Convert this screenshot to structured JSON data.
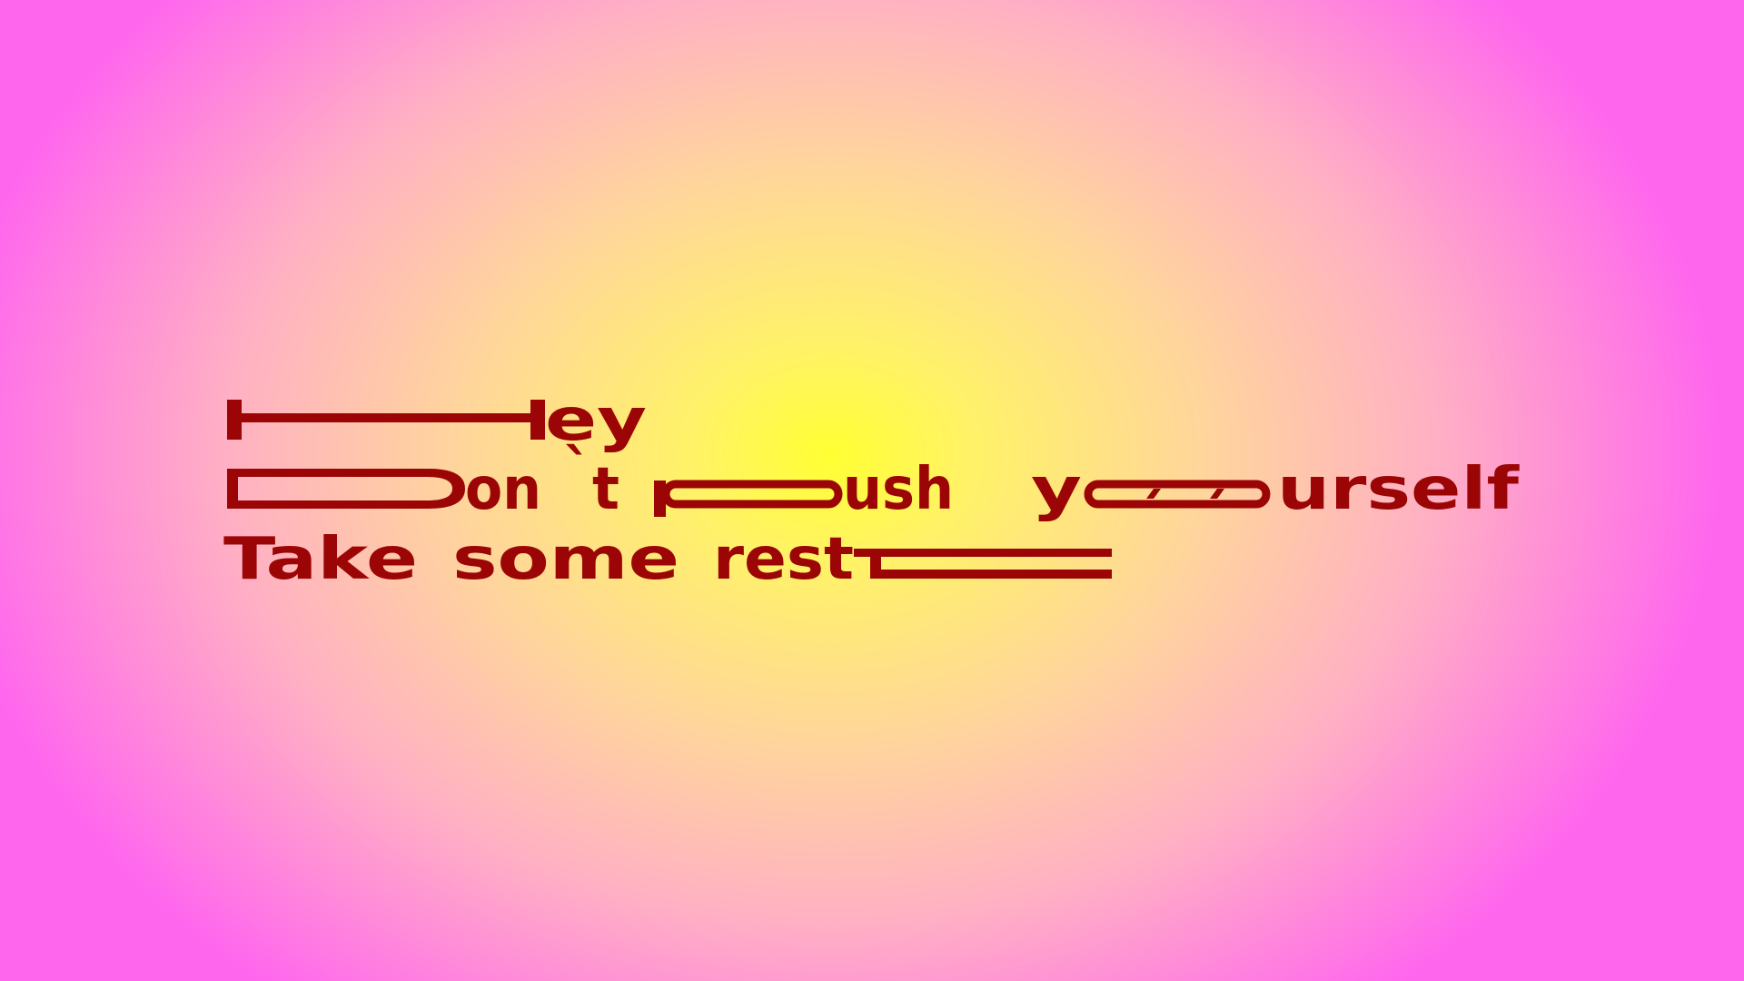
{
  "poster": {
    "lines": [
      {
        "segments": [
          "ey"
        ]
      },
      {
        "segments": [
          "on",
          "`",
          "t",
          "p",
          "ush",
          "y",
          "urself"
        ]
      },
      {
        "segments": [
          "Take",
          "some",
          "rest"
        ]
      }
    ]
  },
  "colors": {
    "text": "#9b0505",
    "center": "#ffff33",
    "edge": "#ff66ee"
  }
}
